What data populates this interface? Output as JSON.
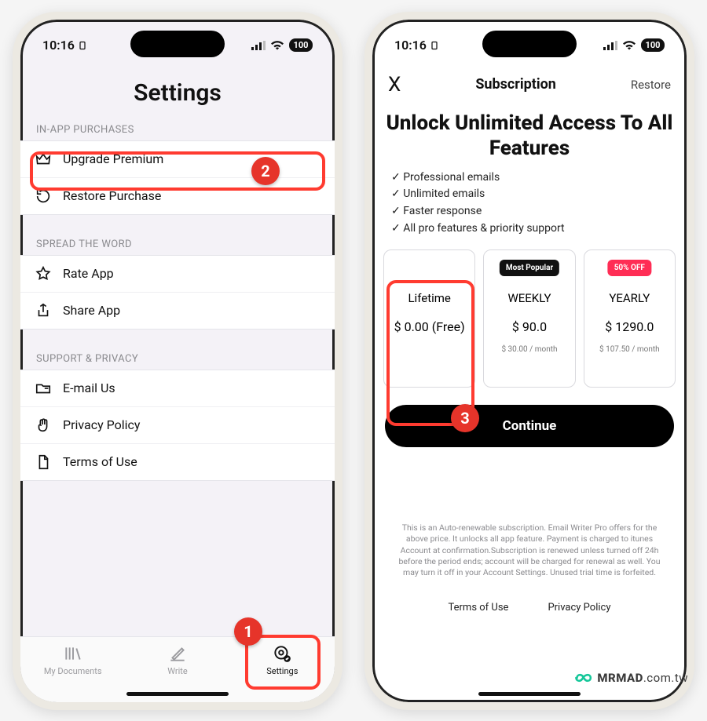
{
  "status": {
    "time": "10:16",
    "battery": "100"
  },
  "left": {
    "title": "Settings",
    "sections": {
      "iap": {
        "header": "IN-APP PURCHASES",
        "rows": {
          "upgrade": "Upgrade Premium",
          "restore": "Restore Purchase"
        }
      },
      "spread": {
        "header": "SPREAD THE WORD",
        "rows": {
          "rate": "Rate App",
          "share": "Share App"
        }
      },
      "support": {
        "header": "SUPPORT & PRIVACY",
        "rows": {
          "email": "E-mail Us",
          "privacy": "Privacy Policy",
          "terms": "Terms of Use"
        }
      }
    },
    "tabs": {
      "docs": "My Documents",
      "write": "Write",
      "settings": "Settings"
    },
    "badges": {
      "b1": "1",
      "b2": "2"
    }
  },
  "right": {
    "header": {
      "close": "X",
      "title": "Subscription",
      "restore": "Restore"
    },
    "hero": "Unlock Unlimited Access To All Features",
    "features": {
      "f1": "✓ Professional emails",
      "f2": "✓ Unlimited emails",
      "f3": "✓ Faster response",
      "f4": "✓ All pro features & priority support"
    },
    "plans": {
      "lifetime": {
        "name": "Lifetime",
        "price": "$ 0.00 (Free)"
      },
      "weekly": {
        "tag": "Most Popular",
        "name": "WEEKLY",
        "price": "$ 90.0",
        "sub": "$ 30.00 / month"
      },
      "yearly": {
        "tag": "50% OFF",
        "name": "YEARLY",
        "price": "$ 1290.0",
        "sub": "$ 107.50 / month"
      }
    },
    "continue": "Continue",
    "fineprint": "This is an Auto-renewable subscription. Email Writer Pro offers for the above price. It unlocks all app feature. Payment is charged to itunes Account at confirmation.Subscription is renewed unless turned off 24h before the period ends; account will be charged for renewal as well. You may turn it off in your Account Settings. Unused trial time is forfeited.",
    "footer": {
      "terms": "Terms of Use",
      "privacy": "Privacy Policy"
    },
    "badges": {
      "b3": "3"
    }
  },
  "watermark": {
    "brand": "MRMAD",
    "suffix": ".com.tw"
  }
}
